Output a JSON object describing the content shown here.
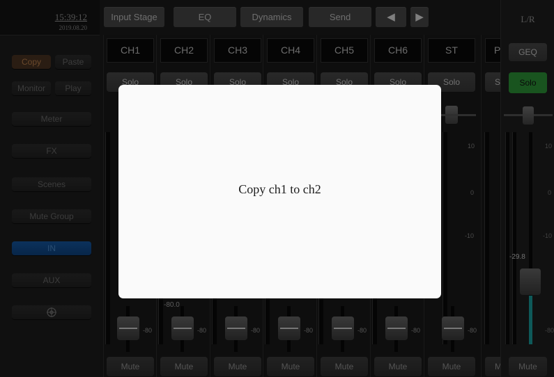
{
  "clock": {
    "time": "15:39:12",
    "date": "2019.08.20"
  },
  "left": {
    "copy": "Copy",
    "paste": "Paste",
    "monitor": "Monitor",
    "play": "Play",
    "items": [
      "Meter",
      "FX",
      "Scenes",
      "Mute Group",
      "IN",
      "AUX"
    ],
    "settings_icon": "crosshair-circle-icon"
  },
  "tabs": {
    "input_stage": "Input Stage",
    "eq": "EQ",
    "dynamics": "Dynamics",
    "send": "Send",
    "prev": "◀",
    "next": "▶"
  },
  "channels": [
    {
      "name": "CH1",
      "solo": "Solo",
      "mute": "Mute",
      "level": "-80"
    },
    {
      "name": "CH2",
      "solo": "Solo",
      "mute": "Mute",
      "level": "-80",
      "fader_value": "-80.0"
    },
    {
      "name": "CH3",
      "solo": "Solo",
      "mute": "Mute",
      "level": "-80"
    },
    {
      "name": "CH4",
      "solo": "Solo",
      "mute": "Mute",
      "level": "-80"
    },
    {
      "name": "CH5",
      "solo": "Solo",
      "mute": "Mute",
      "level": "-80"
    },
    {
      "name": "CH6",
      "solo": "Solo",
      "mute": "Mute",
      "level": "-80"
    },
    {
      "name": "ST",
      "solo": "Solo",
      "mute": "Mute",
      "level": "-80"
    }
  ],
  "partial_channel": {
    "name": "P",
    "solo": "S",
    "mute": "M"
  },
  "scale": {
    "s10": "10",
    "s0": "0",
    "sm10": "-10"
  },
  "lr": {
    "title": "L/R",
    "geq": "GEQ",
    "solo": "Solo",
    "mute": "Mute",
    "fader_value": "-29.8",
    "s10": "10",
    "s0": "0",
    "sm10": "-10",
    "sm80": "-80",
    "solo_color": "#2e9a3a",
    "meter_color": "#1aa3a3"
  },
  "modal": {
    "message": "Copy ch1 to ch2"
  }
}
